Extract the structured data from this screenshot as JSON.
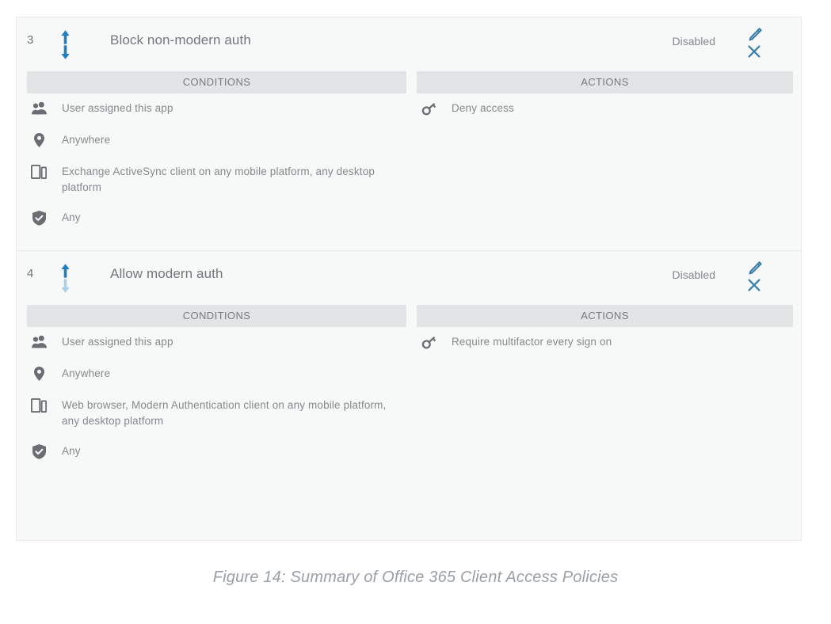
{
  "card": {
    "column_headers": {
      "conditions": "CONDITIONS",
      "actions": "ACTIONS"
    },
    "policies": [
      {
        "index": "3",
        "name": "Block non-modern auth",
        "status": "Disabled",
        "move_up_enabled": true,
        "move_down_enabled": true,
        "edit_icon": "pencil-icon",
        "delete_icon": "close-x-icon",
        "conditions": [
          {
            "icon": "users-icon",
            "text": "User assigned this app"
          },
          {
            "icon": "location-pin-icon",
            "text": "Anywhere"
          },
          {
            "icon": "devices-icon",
            "text": "Exchange ActiveSync client on any mobile platform, any desktop platform"
          },
          {
            "icon": "shield-check-icon",
            "text": "Any"
          }
        ],
        "actions": [
          {
            "icon": "key-icon",
            "text": "Deny access"
          }
        ]
      },
      {
        "index": "4",
        "name": "Allow modern auth",
        "status": "Disabled",
        "move_up_enabled": true,
        "move_down_enabled": false,
        "edit_icon": "pencil-icon",
        "delete_icon": "close-x-icon",
        "conditions": [
          {
            "icon": "users-icon",
            "text": "User assigned this app"
          },
          {
            "icon": "location-pin-icon",
            "text": "Anywhere"
          },
          {
            "icon": "devices-icon",
            "text": "Web browser, Modern Authentication client on any mobile platform, any desktop platform"
          },
          {
            "icon": "shield-check-icon",
            "text": "Any"
          }
        ],
        "actions": [
          {
            "icon": "key-icon",
            "text": "Require multifactor every sign on"
          }
        ]
      }
    ]
  },
  "caption": "Figure 14: Summary of Office 365 Client Access Policies",
  "colors": {
    "accent_blue": "#1f7ec2",
    "accent_blue_faded": "#a9d2ea",
    "tool_blue": "#3d7fa8",
    "card_background": "#f7f8f8",
    "column_header_background": "#e3e4e5",
    "text_gray": "#85898d",
    "icon_gray": "#6a6e72",
    "caption_gray": "#9aa0a6"
  }
}
